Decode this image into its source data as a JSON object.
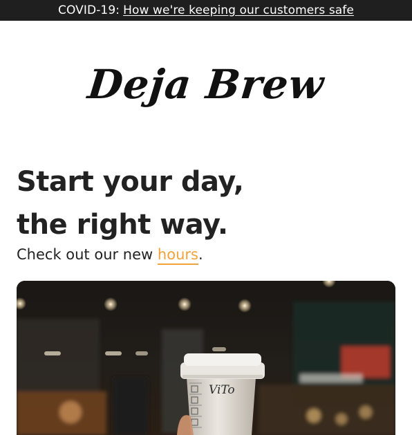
{
  "banner": {
    "prefix": "COVID-19:",
    "link": "How we're keeping our customers safe"
  },
  "logo": {
    "text": "Deja Brew"
  },
  "hero": {
    "headline_line1": "Start your day,",
    "headline_line2": "the right way.",
    "sub_prefix": "Check out our new",
    "sub_link": "hours",
    "sub_suffix": "."
  },
  "photo": {
    "cup_text": "ViTo"
  },
  "colors": {
    "banner_bg": "#1f1f1f",
    "accent": "#f2a23a",
    "text": "#222222"
  }
}
